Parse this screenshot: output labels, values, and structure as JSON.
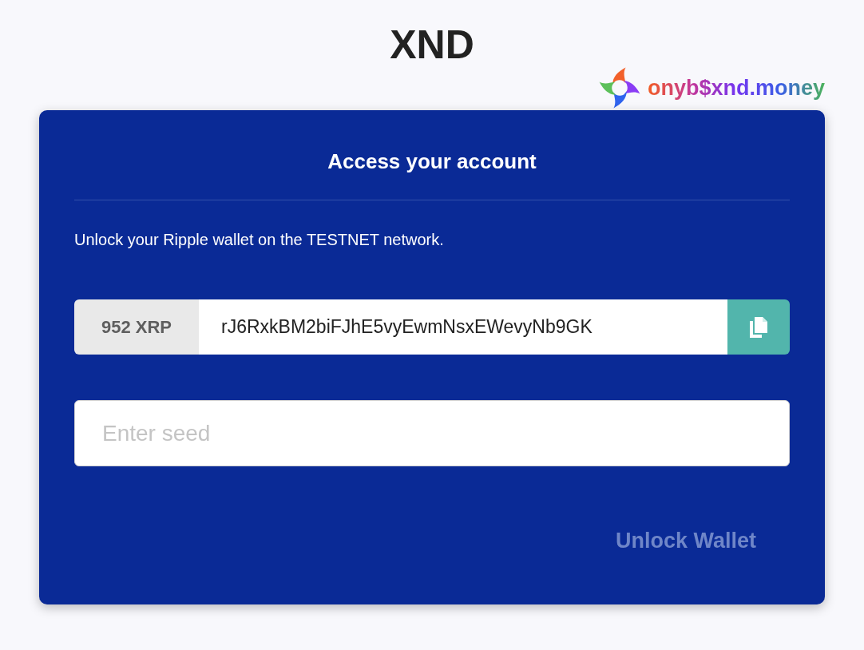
{
  "header": {
    "title": "XND"
  },
  "brand": {
    "name": "onyb$xnd.money"
  },
  "card": {
    "title": "Access your account",
    "description": "Unlock your Ripple wallet on the TESTNET network.",
    "wallet": {
      "balance": "952 XRP",
      "address": "rJ6RxkBM2biFJhE5vyEwmNsxEWevyNb9GK"
    },
    "seed_field": {
      "placeholder": "Enter seed"
    },
    "unlock_button": {
      "label": "Unlock Wallet",
      "disabled": true
    }
  }
}
